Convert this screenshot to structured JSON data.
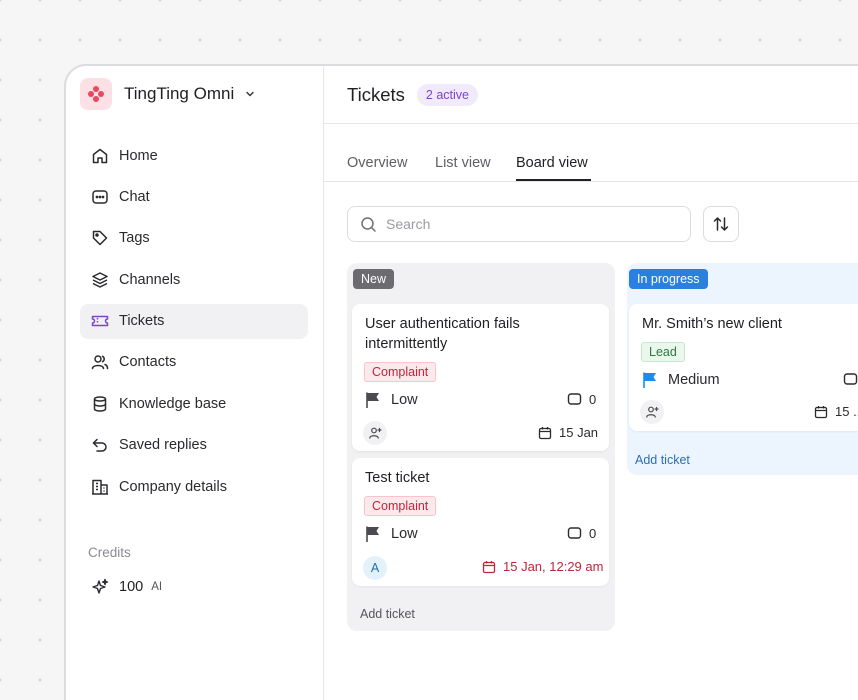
{
  "workspace": {
    "name": "TingTing Omni",
    "logo_color": "#e8495f"
  },
  "sidebar": {
    "items": [
      {
        "label": "Home",
        "icon": "home-icon"
      },
      {
        "label": "Chat",
        "icon": "chat-icon"
      },
      {
        "label": "Tags",
        "icon": "tag-icon"
      },
      {
        "label": "Channels",
        "icon": "layers-icon"
      },
      {
        "label": "Tickets",
        "icon": "ticket-icon",
        "active": true
      },
      {
        "label": "Contacts",
        "icon": "users-icon"
      },
      {
        "label": "Knowledge base",
        "icon": "database-icon"
      },
      {
        "label": "Saved replies",
        "icon": "reply-icon"
      },
      {
        "label": "Company details",
        "icon": "building-icon"
      }
    ],
    "credits": {
      "title": "Credits",
      "value": "100",
      "unit": "AI"
    }
  },
  "header": {
    "title": "Tickets",
    "badge": "2 active"
  },
  "tabs": [
    {
      "label": "Overview"
    },
    {
      "label": "List view"
    },
    {
      "label": "Board view",
      "active": true
    }
  ],
  "search": {
    "placeholder": "Search"
  },
  "board": {
    "columns": [
      {
        "label": "New",
        "color": "#6b6b70",
        "cards": [
          {
            "title": "User authentication fails intermittently",
            "tag": "Complaint",
            "priority": "Low",
            "comments": "0",
            "date": "15 Jan"
          },
          {
            "title": "Test ticket",
            "tag": "Complaint",
            "priority": "Low",
            "comments": "0",
            "assignee": "A",
            "date": "15 Jan, 12:29 am"
          }
        ],
        "add_label": "Add ticket"
      },
      {
        "label": "In progress",
        "color": "#2b7fe0",
        "cards": [
          {
            "title": "Mr. Smith’s new client",
            "tag": "Lead",
            "priority": "Medium",
            "date": "15 ..."
          }
        ],
        "add_label": "Add ticket"
      }
    ]
  },
  "colors": {
    "accent_purple": "#7a45c9",
    "complaint_red": "#c0253b",
    "lead_green": "#2f7a3e",
    "progress_blue": "#2b7fe0",
    "flag_blue": "#1a8cf0"
  }
}
